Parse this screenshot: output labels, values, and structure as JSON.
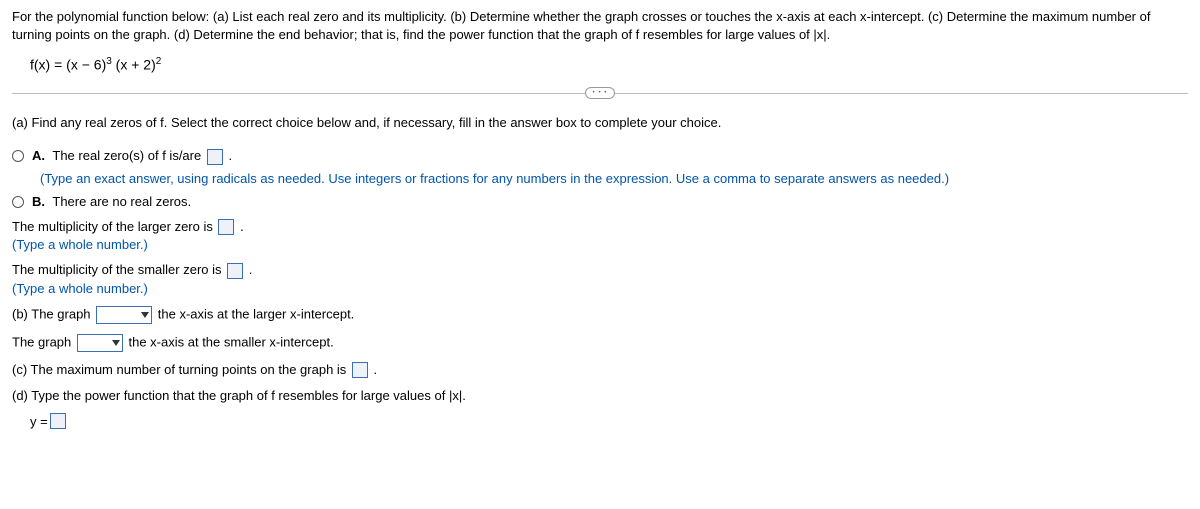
{
  "question": {
    "intro": "For the polynomial function below: (a) List each real zero and its multiplicity. (b) Determine whether the graph crosses or touches the x-axis at each x-intercept. (c) Determine the maximum number of turning points on the graph. (d) Determine the end behavior; that is, find the power function that the graph of f resembles for large values of |x|.",
    "formula_lhs": "f(x) = (x − 6)",
    "formula_exp1": "3",
    "formula_mid": " (x + 2)",
    "formula_exp2": "2"
  },
  "partA": {
    "prompt": "(a) Find any real zeros of f. Select the correct choice below and, if necessary, fill in the answer box to complete your choice.",
    "choiceA_label": "A.",
    "choiceA_before": "The real zero(s) of f is/are ",
    "choiceA_after": ".",
    "choiceA_hint": "(Type an exact answer, using radicals as needed. Use integers or fractions for any numbers in the expression. Use a comma to separate answers as needed.)",
    "choiceB_label": "B.",
    "choiceB_text": "There are no real zeros."
  },
  "multiplicity": {
    "larger_before": "The multiplicity of the larger zero is ",
    "larger_after": ".",
    "larger_hint": "(Type a whole number.)",
    "smaller_before": "The multiplicity of the smaller zero is ",
    "smaller_after": ".",
    "smaller_hint": "(Type a whole number.)"
  },
  "partB": {
    "line1_before": "(b) The graph ",
    "line1_after": " the x-axis at the larger x-intercept.",
    "line2_before": "The graph ",
    "line2_after": " the x-axis at the smaller x-intercept."
  },
  "partC": {
    "before": "(c) The maximum number of turning points on the graph is ",
    "after": "."
  },
  "partD": {
    "prompt": "(d) Type the power function that the graph of f resembles for large values of |x|.",
    "eq": "y ="
  },
  "pill_dots": "• • •"
}
